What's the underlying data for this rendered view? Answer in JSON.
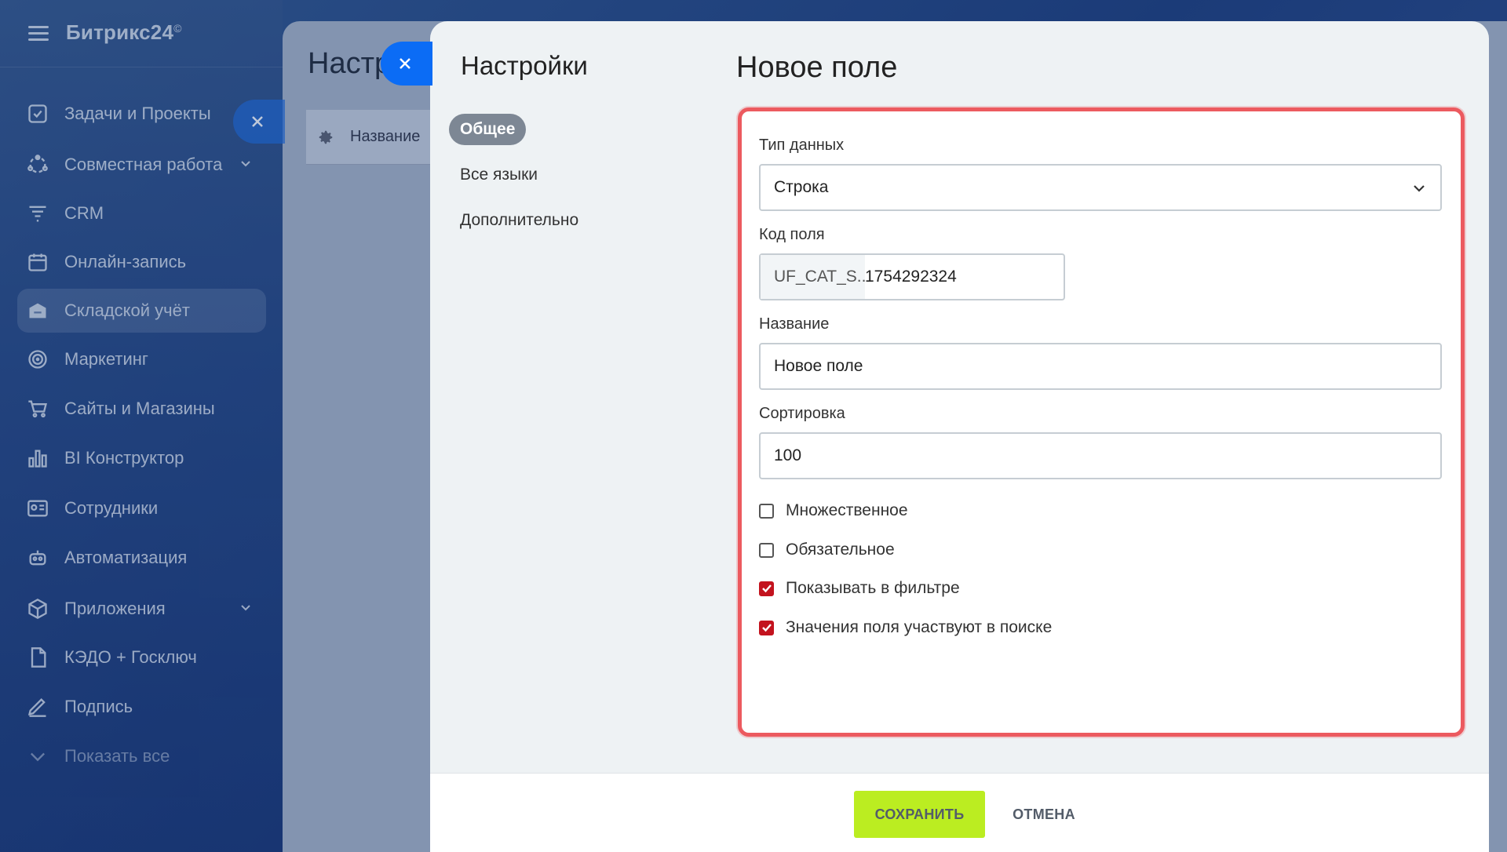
{
  "sidebar": {
    "logo": "Битрикс24",
    "logo_mark": "©",
    "items": [
      {
        "label": "Задачи и Проекты",
        "icon": "tasks-icon"
      },
      {
        "label": "Совместная работа",
        "icon": "collab-icon"
      },
      {
        "label": "CRM",
        "icon": "crm-icon"
      },
      {
        "label": "Онлайн-запись",
        "icon": "calendar-icon"
      },
      {
        "label": "Складской учёт",
        "icon": "warehouse-icon"
      },
      {
        "label": "Маркетинг",
        "icon": "marketing-icon"
      },
      {
        "label": "Сайты и Магазины",
        "icon": "cart-icon"
      },
      {
        "label": "BI Конструктор",
        "icon": "bi-chart-icon"
      },
      {
        "label": "Сотрудники",
        "icon": "employees-icon"
      },
      {
        "label": "Автоматизация",
        "icon": "robot-icon"
      },
      {
        "label": "Приложения",
        "icon": "apps-icon"
      },
      {
        "label": "КЭДО + Госключ",
        "icon": "doc-icon"
      },
      {
        "label": "Подпись",
        "icon": "signature-icon"
      },
      {
        "label": "Показать все",
        "icon": "chevron-down-icon"
      }
    ]
  },
  "back_panel": {
    "title": "Настройки",
    "row_label": "Название"
  },
  "slider": {
    "nav_title": "Настройки",
    "nav": [
      "Общее",
      "Все языки",
      "Дополнительно"
    ],
    "page_title": "Новое поле"
  },
  "form": {
    "type_label": "Тип данных",
    "type_value": "Строка",
    "code_label": "Код поля",
    "code_prefix": "UF_CAT_S...",
    "code_value": "1754292324",
    "name_label": "Название",
    "name_value": "Новое поле",
    "sort_label": "Сортировка",
    "sort_value": "100",
    "checkboxes": [
      {
        "label": "Множественное",
        "checked": false
      },
      {
        "label": "Обязательное",
        "checked": false
      },
      {
        "label": "Показывать в фильтре",
        "checked": true
      },
      {
        "label": "Значения поля участвуют в поиске",
        "checked": true
      }
    ]
  },
  "footer": {
    "save": "СОХРАНИТЬ",
    "cancel": "ОТМЕНА"
  },
  "colors": {
    "save_button": "#bbed21",
    "highlight_border": "#ec5a5f",
    "checkbox_on": "#c3131e",
    "close_button": "#0b6cf5"
  }
}
